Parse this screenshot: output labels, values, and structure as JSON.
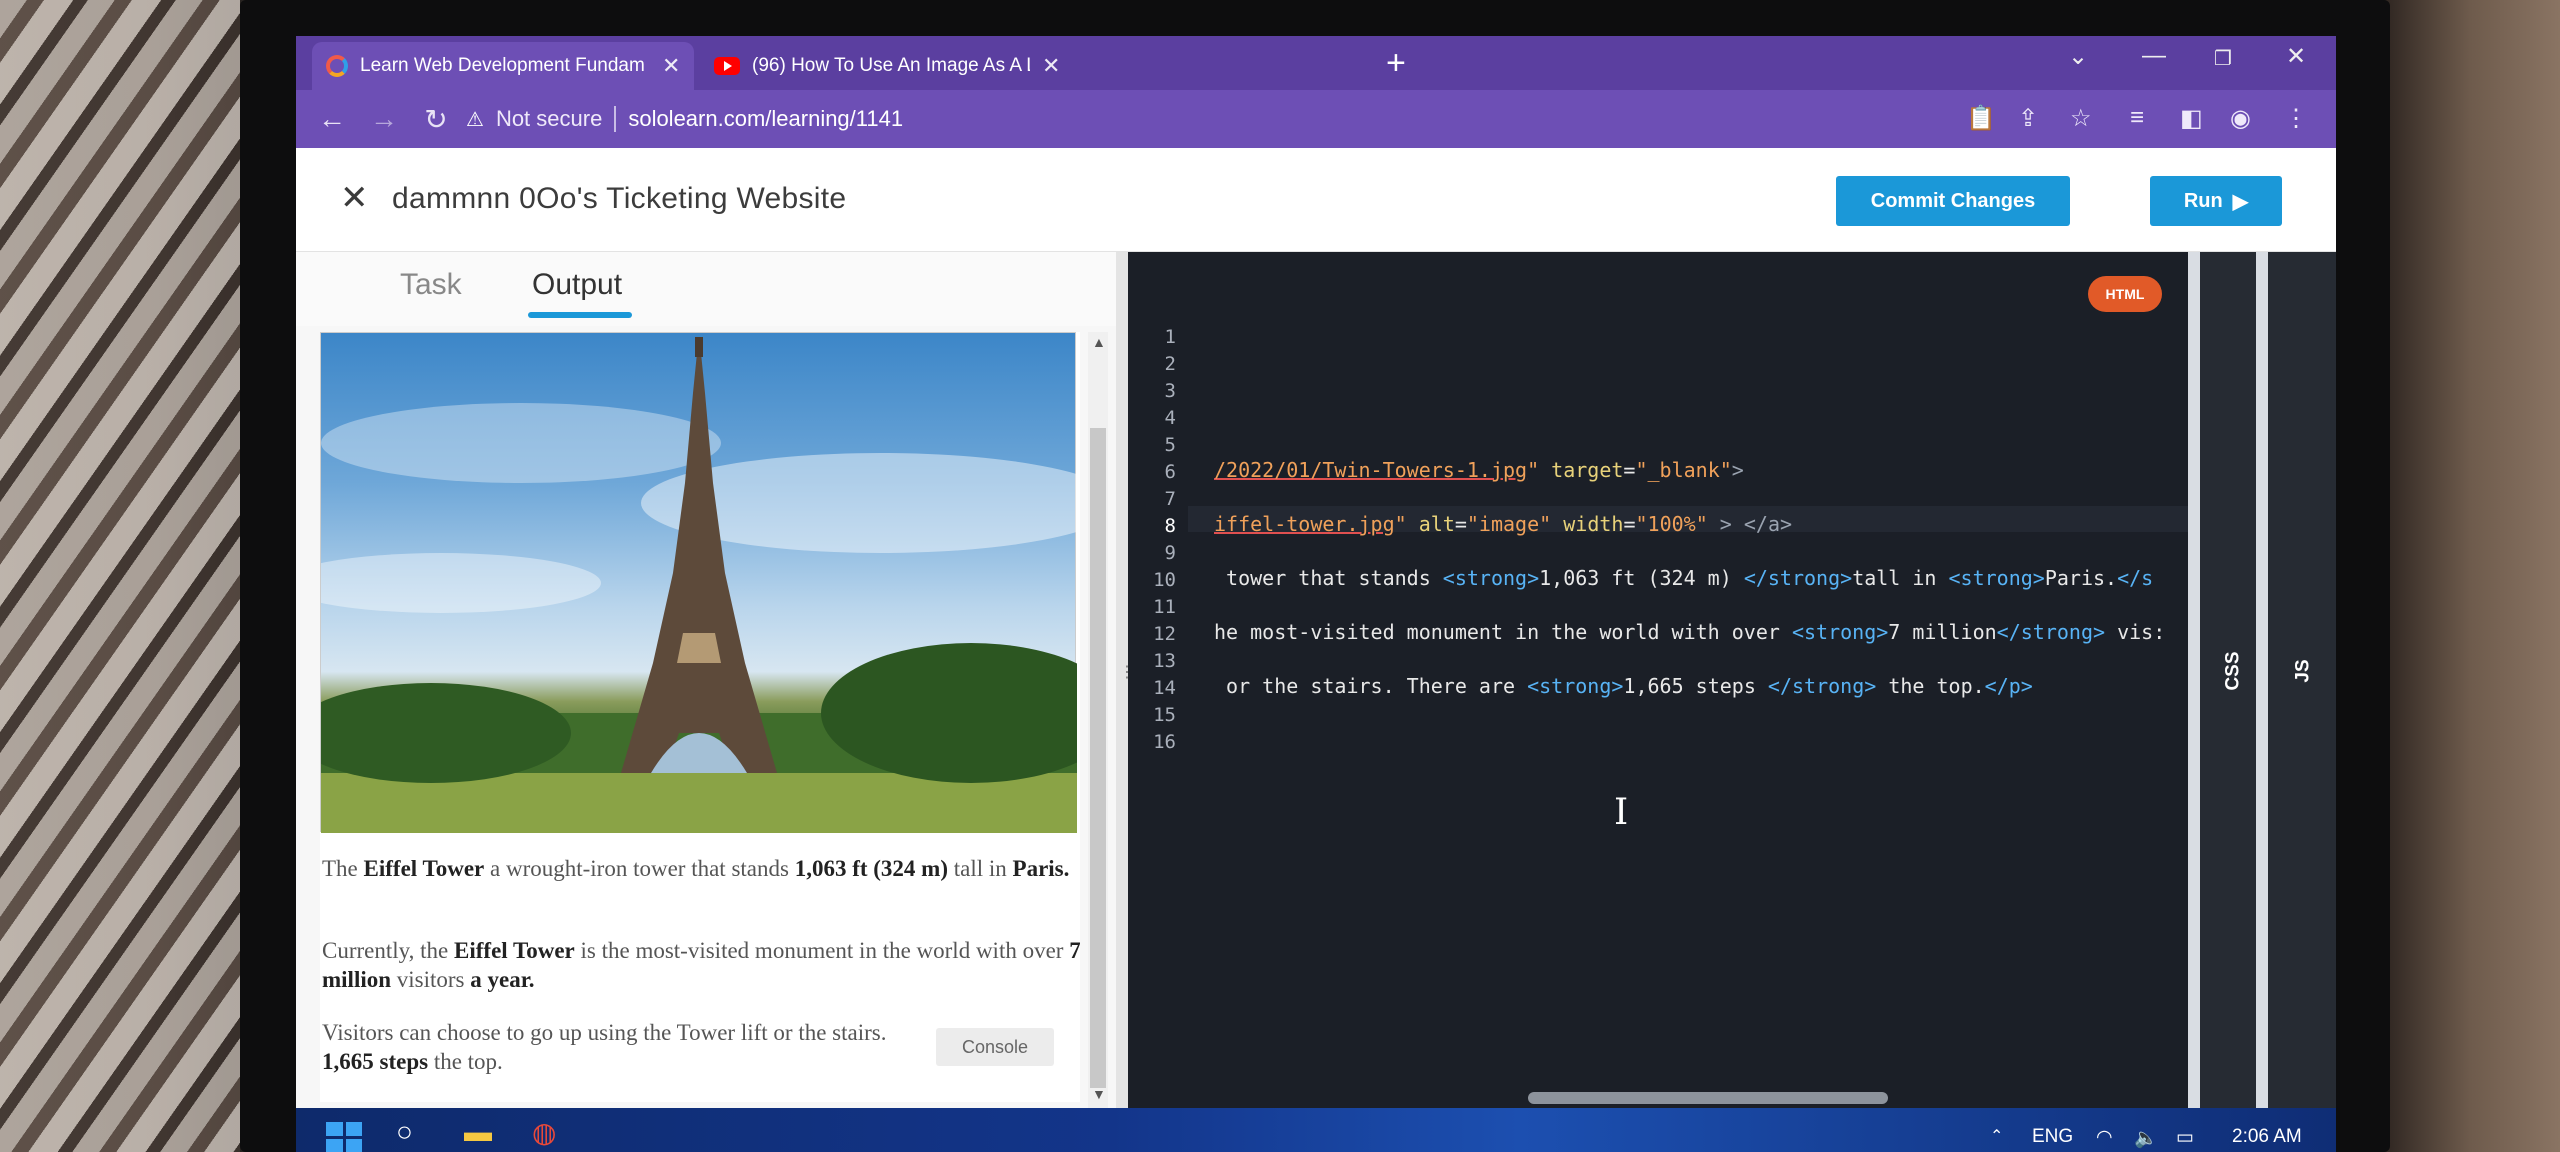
{
  "browser": {
    "tabs": [
      {
        "title": "Learn Web Development Fundam",
        "active": true
      },
      {
        "title": "(96) How To Use An Image As A L",
        "active": false
      }
    ],
    "address": {
      "security": "Not secure",
      "url": "sololearn.com/learning/1141"
    }
  },
  "app": {
    "project_title": "dammnn 0Oo's Ticketing Website",
    "commit_label": "Commit Changes",
    "run_label": "Run",
    "tabs": {
      "task": "Task",
      "output": "Output"
    },
    "output": {
      "p1": {
        "pre": "The ",
        "b1": "Eiffel Tower",
        "mid": " a wrought-iron tower that stands ",
        "b2": "1,063 ft (324 m)",
        "post": " tall in ",
        "b3": "Paris."
      },
      "p2": {
        "pre": "Currently, the ",
        "b1": "Eiffel Tower",
        "mid": " is the most-visited monument in the world with over ",
        "b2": "7 million",
        "mid2": " visitors ",
        "b3": "a year."
      },
      "p3": {
        "pre": "Visitors can choose to go up using the Tower lift or the stairs.",
        "b1": "1,665 steps",
        "post": " the top."
      },
      "console_label": "Console"
    },
    "editor": {
      "language_badge": "HTML",
      "line_numbers": [
        "1",
        "2",
        "3",
        "4",
        "5",
        "6",
        "7",
        "8",
        "9",
        "10",
        "11",
        "12",
        "13",
        "14",
        "15",
        "16"
      ],
      "current_line": "8",
      "code": {
        "l6": {
          "a": "/2022/01/Twin-Towers-1.jpg",
          "b": "\" ",
          "c": "target",
          "d": "=",
          "e": "\"_blank\"",
          "f": ">"
        },
        "l8": {
          "a": "iffel-tower.jpg",
          "b": "\" ",
          "c": "alt",
          "d": "=",
          "e": "\"image\"",
          "f": " ",
          "g": "width",
          "h": "=",
          "i": "\"100%\"",
          "j": " > </a>"
        },
        "l10": {
          "a": " tower that stands ",
          "b": "<strong>",
          "c": "1,063 ft (324 m) ",
          "d": "</strong>",
          "e": "tall in ",
          "f": "<strong>",
          "g": "Paris.",
          "h": "</s"
        },
        "l12": {
          "a": "he most-visited monument in the world with over ",
          "b": "<strong>",
          "c": "7 million",
          "d": "</strong>",
          "e": " vis:"
        },
        "l14": {
          "a": " or the stairs. There are ",
          "b": "<strong>",
          "c": "1,665 steps ",
          "d": "</strong>",
          "e": " the top.",
          "f": "</p>"
        }
      }
    },
    "side_tabs": {
      "css": "CSS",
      "js": "JS"
    }
  },
  "taskbar": {
    "lang": "ENG",
    "time": "2:06 AM"
  }
}
